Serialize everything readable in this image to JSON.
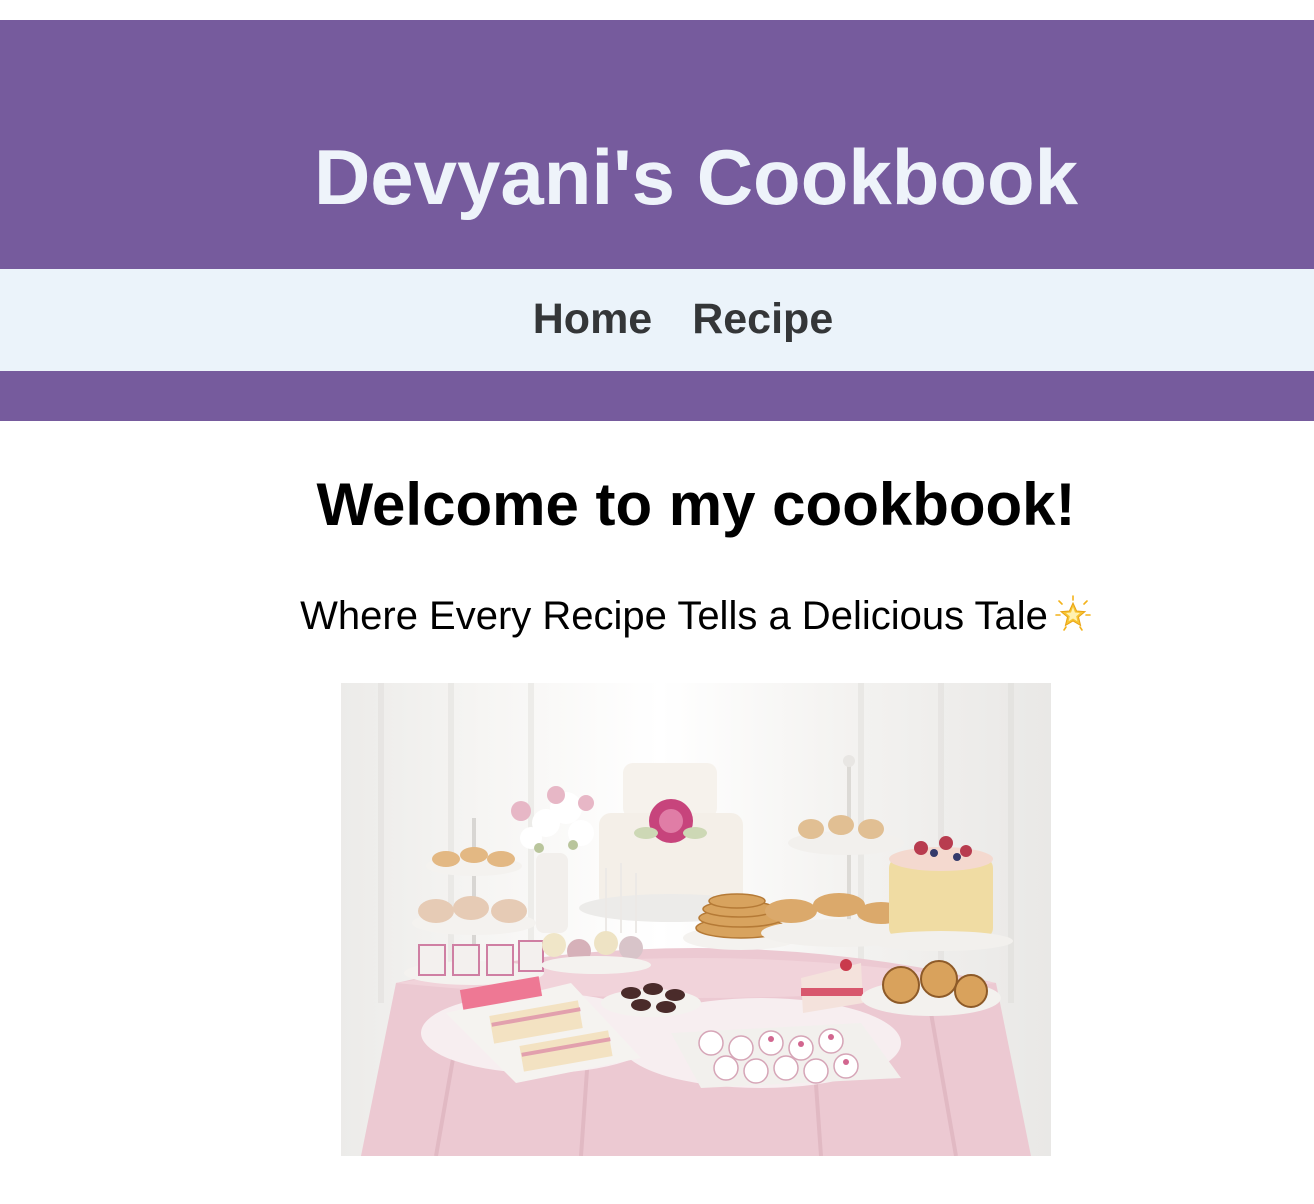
{
  "header": {
    "title": "Devyani's Cookbook"
  },
  "nav": {
    "items": [
      {
        "label": "Home"
      },
      {
        "label": "Recipe"
      }
    ]
  },
  "main": {
    "welcome": "Welcome to my cookbook!",
    "tagline": "Where Every Recipe Tells a Delicious Tale",
    "tagline_icon": "glowing-star-icon",
    "hero_image": "dessert-table-image"
  },
  "colors": {
    "header_bg": "#765b9d",
    "title_text": "#eef3fa",
    "nav_bg": "#ebf3fa",
    "nav_text": "#343638"
  }
}
